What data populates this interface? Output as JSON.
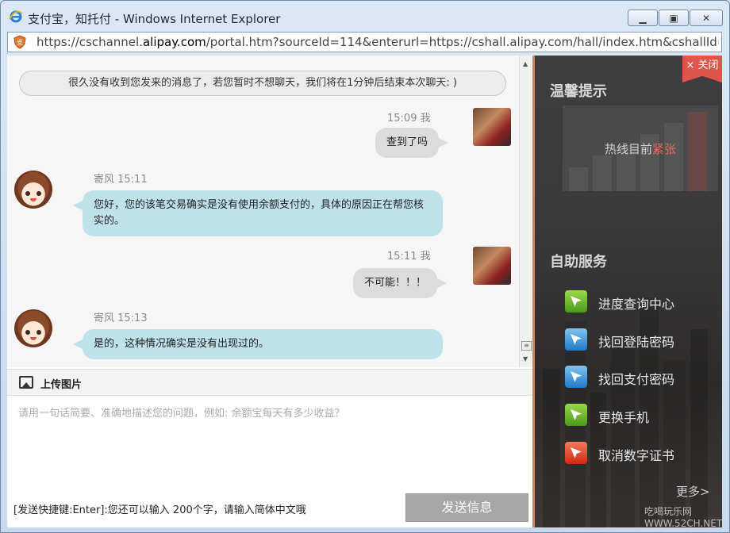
{
  "window": {
    "title": "支付宝，知托付 - Windows Internet Explorer",
    "url_pre": "https://cschannel.",
    "url_domain": "alipay.com",
    "url_post": "/portal.htm?sourceId=114&enterurl=https://cshall.alipay.com/hall/index.htm&cshallId=8e",
    "min_glyph": "▁",
    "max_glyph": "▣",
    "close_glyph": "✕"
  },
  "chat": {
    "notice": "很久没有收到您发来的消息了，若您暂时不想聊天，我们将在1分钟后结束本次聊天: )",
    "messages": [
      {
        "sender": "user",
        "meta": "15:09 我",
        "text": "查到了吗"
      },
      {
        "sender": "agent",
        "meta": "寄风 15:11",
        "text": "您好，您的该笔交易确实是没有使用余额支付的，具体的原因正在帮您核实的。"
      },
      {
        "sender": "user",
        "meta": "15:11 我",
        "text": "不可能！！！"
      },
      {
        "sender": "agent",
        "meta": "寄风 15:13",
        "text": "是的，这种情况确实是没有出现过的。"
      }
    ],
    "scroll_up": "▲",
    "scroll_down": "▼",
    "scroll_thumb": "≡"
  },
  "composer": {
    "upload_label": "上传图片",
    "placeholder": "请用一句话简要、准确地描述您的问题，例如: 余额宝每天有多少收益？",
    "hint": "[发送快捷键:Enter]:您还可以输入 200个字，请输入简体中文哦",
    "send_label": "发送信息"
  },
  "side": {
    "close_label": "× 关闭",
    "tips_title": "温馨提示",
    "hotline_prefix": "热线目前",
    "hotline_status": "紧张",
    "services_title": "自助服务",
    "services": [
      {
        "label": "进度查询中心",
        "icon": "progress-query-icon",
        "color": "green"
      },
      {
        "label": "找回登陆密码",
        "icon": "login-password-icon",
        "color": "blue"
      },
      {
        "label": "找回支付密码",
        "icon": "pay-password-icon",
        "color": "blue"
      },
      {
        "label": "更换手机",
        "icon": "change-phone-icon",
        "color": "green"
      },
      {
        "label": "取消数字证书",
        "icon": "cancel-certificate-icon",
        "color": "red"
      }
    ],
    "more_label": "更多>",
    "watermark": "吃喝玩乐网 WWW.52CH.NET"
  }
}
